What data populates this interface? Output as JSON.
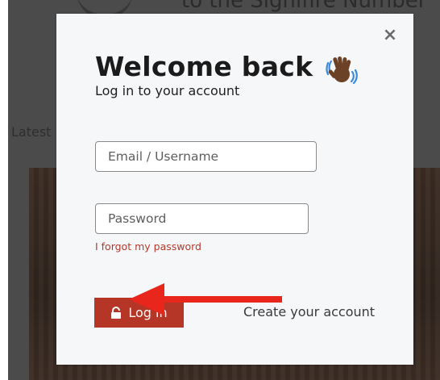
{
  "background": {
    "heading": "to the Signifire Number",
    "latest_label": "Latest"
  },
  "modal": {
    "close_glyph": "×",
    "title": "Welcome back",
    "subtitle": "Log in to your account",
    "email_placeholder": "Email / Username",
    "email_value": "",
    "password_placeholder": "Password",
    "password_value": "",
    "forgot_link": "I forgot my password",
    "login_button": "Log in",
    "create_account_link": "Create your account"
  },
  "icons": {
    "close": "close-icon",
    "wave": "waving-hand-icon",
    "lock": "lock-icon",
    "arrow": "arrow-left-icon"
  },
  "colors": {
    "accent": "#b53527",
    "arrow": "#e8261c",
    "overlay": "#4b4b4b"
  }
}
